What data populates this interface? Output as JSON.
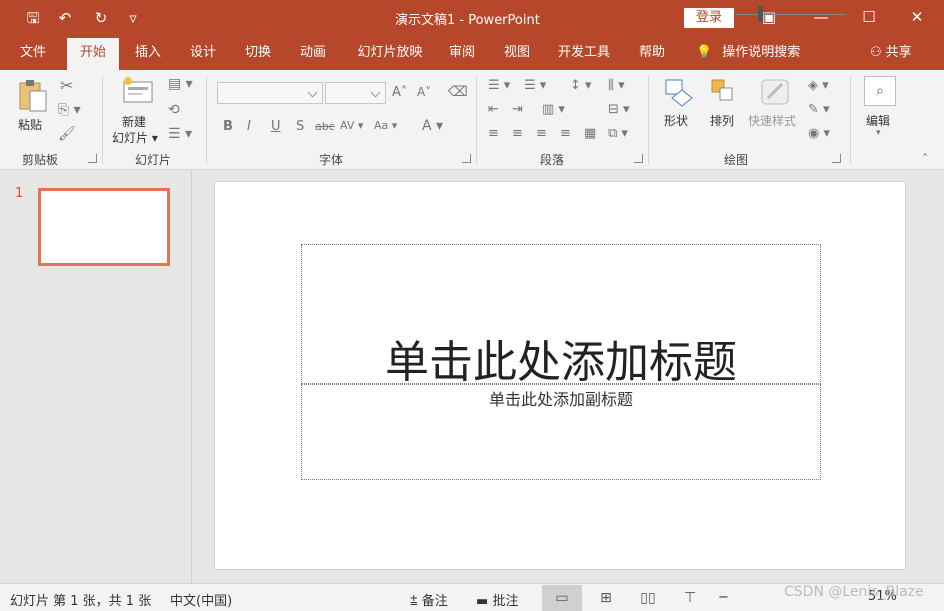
{
  "titlebar": {
    "title": "演示文稿1  -  PowerPoint",
    "login": "登录",
    "icons": [
      "save-icon",
      "undo-icon",
      "redo-icon",
      "customize-qat-icon",
      "ribbon-display-icon",
      "minimize-icon",
      "maximize-icon",
      "close-icon"
    ],
    "save_glyph": "🖫",
    "undo_glyph": "↶",
    "redo_glyph": "↻",
    "qat_glyph": "▿",
    "ribbon_opt_glyph": "▣",
    "minimize_glyph": "—",
    "maximize_glyph": "☐",
    "close_glyph": "✕"
  },
  "tabs": [
    "文件",
    "开始",
    "插入",
    "设计",
    "切换",
    "动画",
    "幻灯片放映",
    "审阅",
    "视图",
    "开发工具",
    "帮助"
  ],
  "tell_me": "操作说明搜索",
  "share": "共享",
  "ribbon": {
    "clipboard": {
      "paste": "粘贴",
      "label": "剪贴板"
    },
    "slides": {
      "new_slide_line1": "新建",
      "new_slide_line2": "幻灯片 ▾",
      "label": "幻灯片"
    },
    "font": {
      "label": "字体",
      "bold": "B",
      "italic": "I",
      "underline": "U",
      "shadow": "S",
      "strike": "abc",
      "spacing": "AV ▾",
      "case": "Aa ▾",
      "color": "A ▾",
      "grow": "A˄",
      "shrink": "A˅"
    },
    "paragraph": {
      "label": "段落"
    },
    "drawing": {
      "shapes": "形状",
      "arrange": "排列",
      "quick_styles": "快速样式",
      "label": "绘图"
    },
    "editing": {
      "edit": "编辑"
    }
  },
  "thumbnails": [
    {
      "number": "1"
    }
  ],
  "slide": {
    "title_placeholder": "单击此处添加标题",
    "subtitle_placeholder": "单击此处添加副标题"
  },
  "status": {
    "slide_info": "幻灯片 第 1 张，共 1 张",
    "language": "中文(中国)",
    "notes": "备注",
    "comments": "批注",
    "zoom_minus": "−",
    "zoom_pct": "51%",
    "watermark": "CSDN @Lenis_Blaze"
  },
  "colors": {
    "accent": "#b7472a",
    "selection": "#e57354"
  }
}
